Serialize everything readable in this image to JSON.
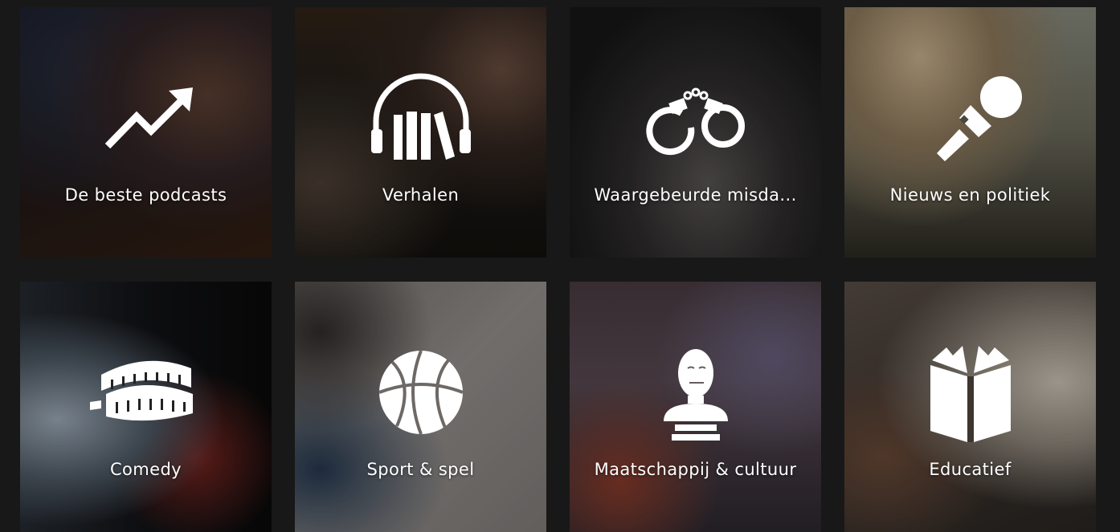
{
  "categories": [
    {
      "label": "De beste podcasts",
      "icon": "trending-up-icon"
    },
    {
      "label": "Verhalen",
      "icon": "headphones-books-icon"
    },
    {
      "label": "Waargebeurde misda...",
      "icon": "handcuffs-icon"
    },
    {
      "label": "Nieuws en politiek",
      "icon": "microphone-icon"
    },
    {
      "label": "Comedy",
      "icon": "chattering-teeth-icon"
    },
    {
      "label": "Sport & spel",
      "icon": "basketball-icon"
    },
    {
      "label": "Maatschappij & cultuur",
      "icon": "bust-statue-icon"
    },
    {
      "label": "Educatief",
      "icon": "open-book-icon"
    }
  ],
  "colors": {
    "background": "#181818",
    "text": "#ffffff"
  }
}
